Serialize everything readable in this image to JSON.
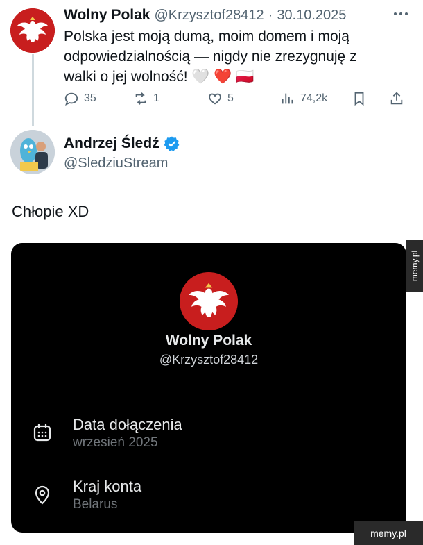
{
  "original_tweet": {
    "author_name": "Wolny Polak",
    "handle": "@Krzysztof28412",
    "separator": "·",
    "date": "30.10.2025",
    "text_lines": [
      "Polska jest moją dumą, moim domem i moją",
      "odpowiedzialnością — nigdy nie zrezygnuję z",
      "walki o jej wolność! 🤍 ❤️ 🇵🇱"
    ],
    "more_icon": "more-dots-icon",
    "actions": {
      "replies": "35",
      "retweets": "1",
      "likes": "5",
      "views": "74,2k"
    }
  },
  "reply": {
    "author_name": "Andrzej Śledź",
    "verified": true,
    "handle": "@SledziuStream",
    "text": "Chłopie XD"
  },
  "profile_card": {
    "name": "Wolny Polak",
    "handle": "@Krzysztof28412",
    "joined_label": "Data dołączenia",
    "joined_value": "wrzesień 2025",
    "country_label": "Kraj konta",
    "country_value": "Belarus"
  },
  "watermark": {
    "side": "memy.pl",
    "bottom": "memy.pl"
  },
  "colors": {
    "verified": "#1d9bf0",
    "muted": "#536471",
    "card_bg": "#000000"
  }
}
